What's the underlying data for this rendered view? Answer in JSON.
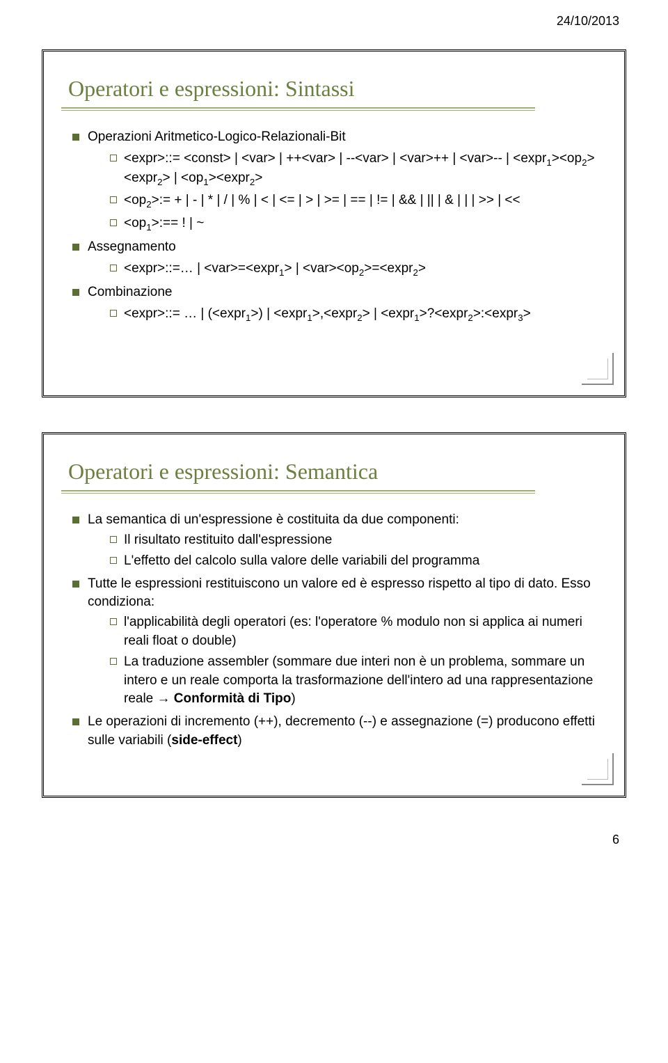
{
  "header": {
    "date": "24/10/2013"
  },
  "footer": {
    "page": "6"
  },
  "slide1": {
    "title": "Operatori e espressioni: Sintassi",
    "b1": "Operazioni Aritmetico-Logico-Relazionali-Bit",
    "s1a_pre": "<expr>::= <const> | <var> | ++<var> | --<var> | <var>++ | <var>-- | <expr",
    "s1a_sub1": "1",
    "s1a_mid1": "><op",
    "s1a_sub2": "2",
    "s1a_mid2": "><expr",
    "s1a_sub3": "2",
    "s1a_mid3": "> | <op",
    "s1a_sub4": "1",
    "s1a_mid4": "><expr",
    "s1a_sub5": "2",
    "s1a_end": ">",
    "s1b_pre": "<op",
    "s1b_sub1": "2",
    "s1b_rest": ">:= + | - | * | / | % | < | <= | > | >= | == | != | && | || | & | | | >> | <<",
    "s1c_pre": "<op",
    "s1c_sub1": "1",
    "s1c_rest": ">:== ! | ~",
    "b2": "Assegnamento",
    "s2_pre": "<expr>::=… | <var>=<expr",
    "s2_sub1": "1",
    "s2_mid1": "> | <var><op",
    "s2_sub2": "2",
    "s2_mid2": ">=<expr",
    "s2_sub3": "2",
    "s2_end": ">",
    "b3": "Combinazione",
    "s3a_pre": "<expr>::= … | (<expr",
    "s3a_sub1": "1",
    "s3a_mid1": ">) | <expr",
    "s3a_sub2": "1",
    "s3a_mid2": ">,<expr",
    "s3a_sub3": "2",
    "s3a_mid3": "> | <expr",
    "s3a_sub4": "1",
    "s3a_mid4": ">?<expr",
    "s3a_sub5": "2",
    "s3a_mid5": ">:<expr",
    "s3a_sub6": "3",
    "s3a_end": ">"
  },
  "slide2": {
    "title": "Operatori e espressioni: Semantica",
    "b1": "La semantica di un'espressione è costituita da due componenti:",
    "b1s1": "Il risultato restituito dall'espressione",
    "b1s2": "L'effetto del calcolo sulla valore delle variabili del programma",
    "b2": "Tutte le espressioni restituiscono un valore ed è espresso rispetto al tipo di dato. Esso condiziona:",
    "b2s1": "l'applicabilità degli operatori (es: l'operatore % modulo non si applica ai numeri reali float o double)",
    "b2s2_pre": "La traduzione assembler (sommare due interi non è un problema, sommare un intero e un reale comporta la trasformazione dell'intero ad una rappresentazione reale ",
    "b2s2_arrow": "→",
    "b2s2_bold": " Conformità di Tipo",
    "b2s2_end": ")",
    "b3_pre": "Le operazioni di incremento (++), decremento (--) e assegnazione (=) producono effetti sulle variabili (",
    "b3_bold": "side-effect",
    "b3_end": ")"
  }
}
